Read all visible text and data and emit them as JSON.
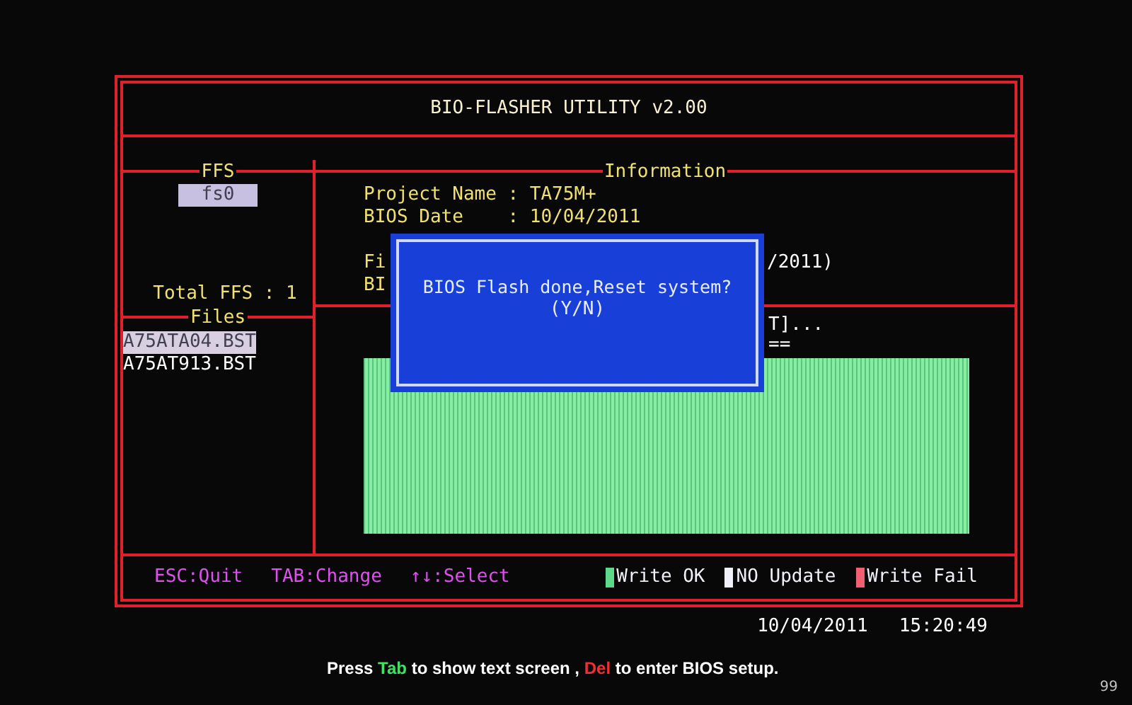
{
  "window": {
    "title": "BIO-FLASHER UTILITY v2.00"
  },
  "ffs": {
    "heading": "FFS",
    "drives": [
      {
        "label": "fs0",
        "selected": true
      }
    ],
    "total": "Total FFS : 1"
  },
  "files": {
    "heading": "Files",
    "items": [
      {
        "label": "A75ATA04.BST",
        "selected": true
      },
      {
        "label": "A75AT913.BST",
        "selected": false
      }
    ]
  },
  "information": {
    "heading": "Information",
    "lines": [
      {
        "left": "Project Name : TA75M+"
      },
      {
        "left": "BIOS Date    : 10/04/2011"
      },
      {
        "left": "Fi",
        "right": "/2011)"
      },
      {
        "left": "BI"
      }
    ],
    "progress_lines": [
      {
        "right": "T]..."
      },
      {
        "right": "=="
      }
    ]
  },
  "dialog": {
    "message": "BIOS Flash done,Reset system?",
    "prompt": "(Y/N)"
  },
  "hints": [
    "ESC:Quit",
    "TAB:Change",
    "↑↓:Select"
  ],
  "legend": [
    {
      "label": "Write OK",
      "color": "#5fd88a"
    },
    {
      "label": "NO Update",
      "color": "#f0f0f8"
    },
    {
      "label": "Write Fail",
      "color": "#f06070"
    }
  ],
  "status": {
    "date": "10/04/2011",
    "time": "15:20:49"
  },
  "footer": {
    "parts": [
      {
        "text": "Press ",
        "kind": "plain"
      },
      {
        "text": "Tab",
        "kind": "accept-key"
      },
      {
        "text": " to show text screen , ",
        "kind": "plain"
      },
      {
        "text": "Del",
        "kind": "delete-key"
      },
      {
        "text": " to enter BIOS setup.",
        "kind": "plain"
      }
    ]
  },
  "corner_number": "99"
}
